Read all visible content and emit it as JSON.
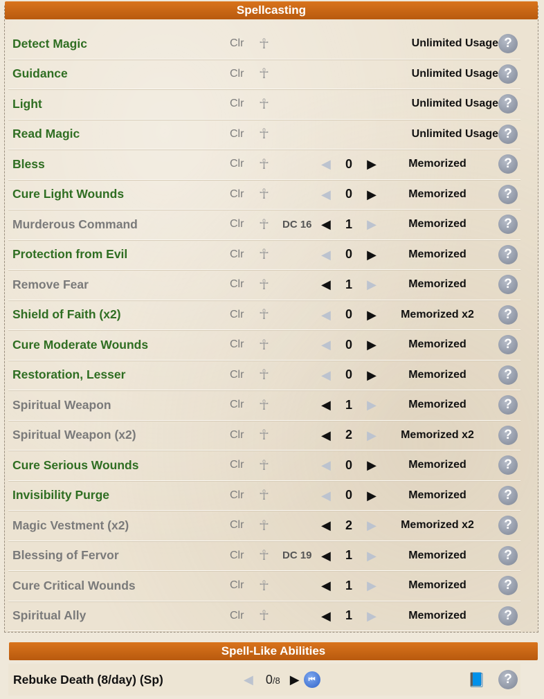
{
  "spellcasting": {
    "title": "Spellcasting",
    "rows": [
      {
        "name": "Detect Magic",
        "class": "Clr",
        "state": "active",
        "dc": "",
        "count": "",
        "status": "Unlimited Usage",
        "kind": "unl"
      },
      {
        "name": "Guidance",
        "class": "Clr",
        "state": "active",
        "dc": "",
        "count": "",
        "status": "Unlimited Usage",
        "kind": "unl"
      },
      {
        "name": "Light",
        "class": "Clr",
        "state": "active",
        "dc": "",
        "count": "",
        "status": "Unlimited Usage",
        "kind": "unl"
      },
      {
        "name": "Read Magic",
        "class": "Clr",
        "state": "active",
        "dc": "",
        "count": "",
        "status": "Unlimited Usage",
        "kind": "unl"
      },
      {
        "name": "Bless",
        "class": "Clr",
        "state": "active",
        "dc": "",
        "count": "0",
        "status": "Memorized",
        "kind": "mem"
      },
      {
        "name": "Cure Light Wounds",
        "class": "Clr",
        "state": "active",
        "dc": "",
        "count": "0",
        "status": "Memorized",
        "kind": "mem"
      },
      {
        "name": "Murderous Command",
        "class": "Clr",
        "state": "used",
        "dc": "DC 16",
        "count": "1",
        "status": "Memorized",
        "kind": "mem"
      },
      {
        "name": "Protection from Evil",
        "class": "Clr",
        "state": "active",
        "dc": "",
        "count": "0",
        "status": "Memorized",
        "kind": "mem"
      },
      {
        "name": "Remove Fear",
        "class": "Clr",
        "state": "used",
        "dc": "",
        "count": "1",
        "status": "Memorized",
        "kind": "mem"
      },
      {
        "name": "Shield of Faith (x2)",
        "class": "Clr",
        "state": "active",
        "dc": "",
        "count": "0",
        "status": "Memorized x2",
        "kind": "mem"
      },
      {
        "name": "Cure Moderate Wounds",
        "class": "Clr",
        "state": "active",
        "dc": "",
        "count": "0",
        "status": "Memorized",
        "kind": "mem"
      },
      {
        "name": "Restoration, Lesser",
        "class": "Clr",
        "state": "active",
        "dc": "",
        "count": "0",
        "status": "Memorized",
        "kind": "mem"
      },
      {
        "name": "Spiritual Weapon",
        "class": "Clr",
        "state": "used",
        "dc": "",
        "count": "1",
        "status": "Memorized",
        "kind": "mem"
      },
      {
        "name": "Spiritual Weapon (x2)",
        "class": "Clr",
        "state": "used",
        "dc": "",
        "count": "2",
        "status": "Memorized x2",
        "kind": "mem"
      },
      {
        "name": "Cure Serious Wounds",
        "class": "Clr",
        "state": "active",
        "dc": "",
        "count": "0",
        "status": "Memorized",
        "kind": "mem"
      },
      {
        "name": "Invisibility Purge",
        "class": "Clr",
        "state": "active",
        "dc": "",
        "count": "0",
        "status": "Memorized",
        "kind": "mem"
      },
      {
        "name": "Magic Vestment (x2)",
        "class": "Clr",
        "state": "used",
        "dc": "",
        "count": "2",
        "status": "Memorized x2",
        "kind": "mem"
      },
      {
        "name": "Blessing of Fervor",
        "class": "Clr",
        "state": "used",
        "dc": "DC 19",
        "count": "1",
        "status": "Memorized",
        "kind": "mem"
      },
      {
        "name": "Cure Critical Wounds",
        "class": "Clr",
        "state": "used",
        "dc": "",
        "count": "1",
        "status": "Memorized",
        "kind": "mem"
      },
      {
        "name": "Spiritual Ally",
        "class": "Clr",
        "state": "used",
        "dc": "",
        "count": "1",
        "status": "Memorized",
        "kind": "mem"
      }
    ]
  },
  "spell_like": {
    "title": "Spell-Like Abilities",
    "ability": {
      "name": "Rebuke Death (8/day) (Sp)",
      "used": "0",
      "max": "/8"
    }
  },
  "colors": {
    "header": "#c8650f",
    "available": "#2f6e22",
    "used": "#7a7a7a"
  },
  "icons": {
    "class_icon": "ankh-icon",
    "help": "help-icon",
    "decrease": "left-arrow-icon",
    "increase": "right-arrow-icon",
    "reset": "rewind-icon",
    "book": "spellbook-icon"
  }
}
